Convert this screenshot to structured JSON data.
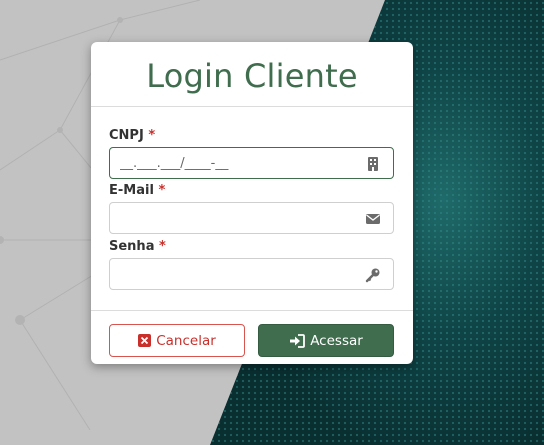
{
  "login": {
    "title": "Login Cliente",
    "cnpj": {
      "label": "CNPJ",
      "required_mark": "*",
      "placeholder": "__.___.___/____-__",
      "icon": "building-icon"
    },
    "email": {
      "label": "E-Mail",
      "required_mark": "*",
      "placeholder": "",
      "icon": "envelope-icon"
    },
    "password": {
      "label": "Senha",
      "required_mark": "*",
      "placeholder": "",
      "icon": "key-icon"
    },
    "cancel_label": "Cancelar",
    "submit_label": "Acessar"
  },
  "colors": {
    "accent": "#3f6d4e",
    "danger": "#c9302c",
    "background_left": "#c2c2c2",
    "background_right": "#0d3a3c"
  }
}
